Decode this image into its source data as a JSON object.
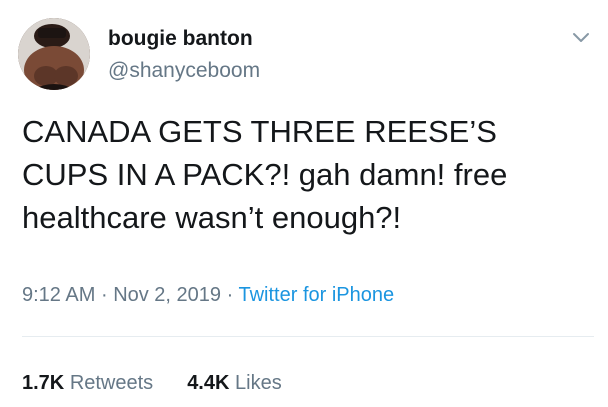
{
  "tweet": {
    "display_name": "bougie banton",
    "handle": "@shanyceboom",
    "text": "CANADA GETS THREE REESE’S\nCUPS IN A PACK?! gah damn! free\nhealthcare wasn’t enough?!",
    "time": "9:12 AM",
    "separator": "·",
    "date": "Nov 2, 2019",
    "source": "Twitter for iPhone",
    "retweets_count": "1.7K",
    "retweets_label": "Retweets",
    "likes_count": "4.4K",
    "likes_label": "Likes"
  },
  "icons": {
    "avatar": "profile-photo",
    "caret": "chevron-down-icon"
  },
  "colors": {
    "text_primary": "#14171a",
    "text_secondary": "#657786",
    "link": "#1b95e0",
    "divider": "#e6ecf0"
  }
}
